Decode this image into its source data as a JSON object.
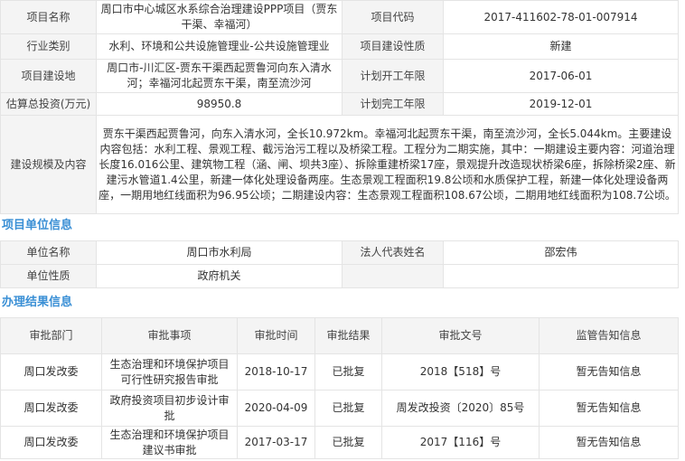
{
  "project_info": {
    "name_label": "项目名称",
    "name_value": "周口市中心城区水系综合治理建设PPP项目（贾东干渠、幸福河）",
    "code_label": "项目代码",
    "code_value": "2017-411602-78-01-007914",
    "industry_label": "行业类别",
    "industry_value": "水利、环境和公共设施管理业-公共设施管理业",
    "nature_label": "项目建设性质",
    "nature_value": "新建",
    "location_label": "项目建设地",
    "location_value": "周口市-川汇区-贾东干渠西起贾鲁河向东入清水河；幸福河北起贾东干渠，南至流沙河",
    "start_label": "计划开工年限",
    "start_value": "2017-06-01",
    "investment_label": "估算总投资(万元)",
    "investment_value": "98950.8",
    "end_label": "计划完工年限",
    "end_value": "2019-12-01",
    "scope_label": "建设规模及内容",
    "scope_value": "贾东干渠西起贾鲁河，向东入清水河，全长10.972km。幸福河北起贾东干渠，南至流沙河，全长5.044km。主要建设内容包括：水利工程、景观工程、截污治污工程以及桥梁工程。工程分为二期实施，其中：一期建设主要内容：河道治理长度16.016公里、建筑物工程（涵、闸、坝共3座）、拆除重建桥梁17座，景观提升改造现状桥梁6座，拆除桥梁2座、新建污水管道1.4公里，新建一体化处理设备两座。生态景观工程面积19.8公顷和水质保护工程，新建一体化处理设备两座，一期用地红线面积为96.95公顷；二期建设内容：生态景观工程面积108.67公顷，二期用地红线面积为108.7公顷。"
  },
  "unit_section": {
    "title": "项目单位信息",
    "unit_name_label": "单位名称",
    "unit_name_value": "周口市水利局",
    "legal_rep_label": "法人代表姓名",
    "legal_rep_value": "邵宏伟",
    "unit_nature_label": "单位性质",
    "unit_nature_value": "政府机关"
  },
  "process_section": {
    "title": "办理结果信息",
    "columns": [
      "审批部门",
      "审批事项",
      "审批时间",
      "审批结果",
      "审批文号",
      "监管告知信息"
    ],
    "rows": [
      {
        "dept": "周口发改委",
        "item": "生态治理和环境保护项目可行性研究报告审批",
        "date": "2018-10-17",
        "result": "已批复",
        "doc": "2018【518】号",
        "notice": "暂无告知信息"
      },
      {
        "dept": "周口发改委",
        "item": "政府投资项目初步设计审批",
        "date": "2020-04-09",
        "result": "已批复",
        "doc": "周发改投资〔2020〕85号",
        "notice": "暂无告知信息"
      },
      {
        "dept": "周口发改委",
        "item": "生态治理和环境保护项目建议书审批",
        "date": "2017-03-17",
        "result": "已批复",
        "doc": "2017【116】号",
        "notice": "暂无告知信息"
      }
    ]
  }
}
